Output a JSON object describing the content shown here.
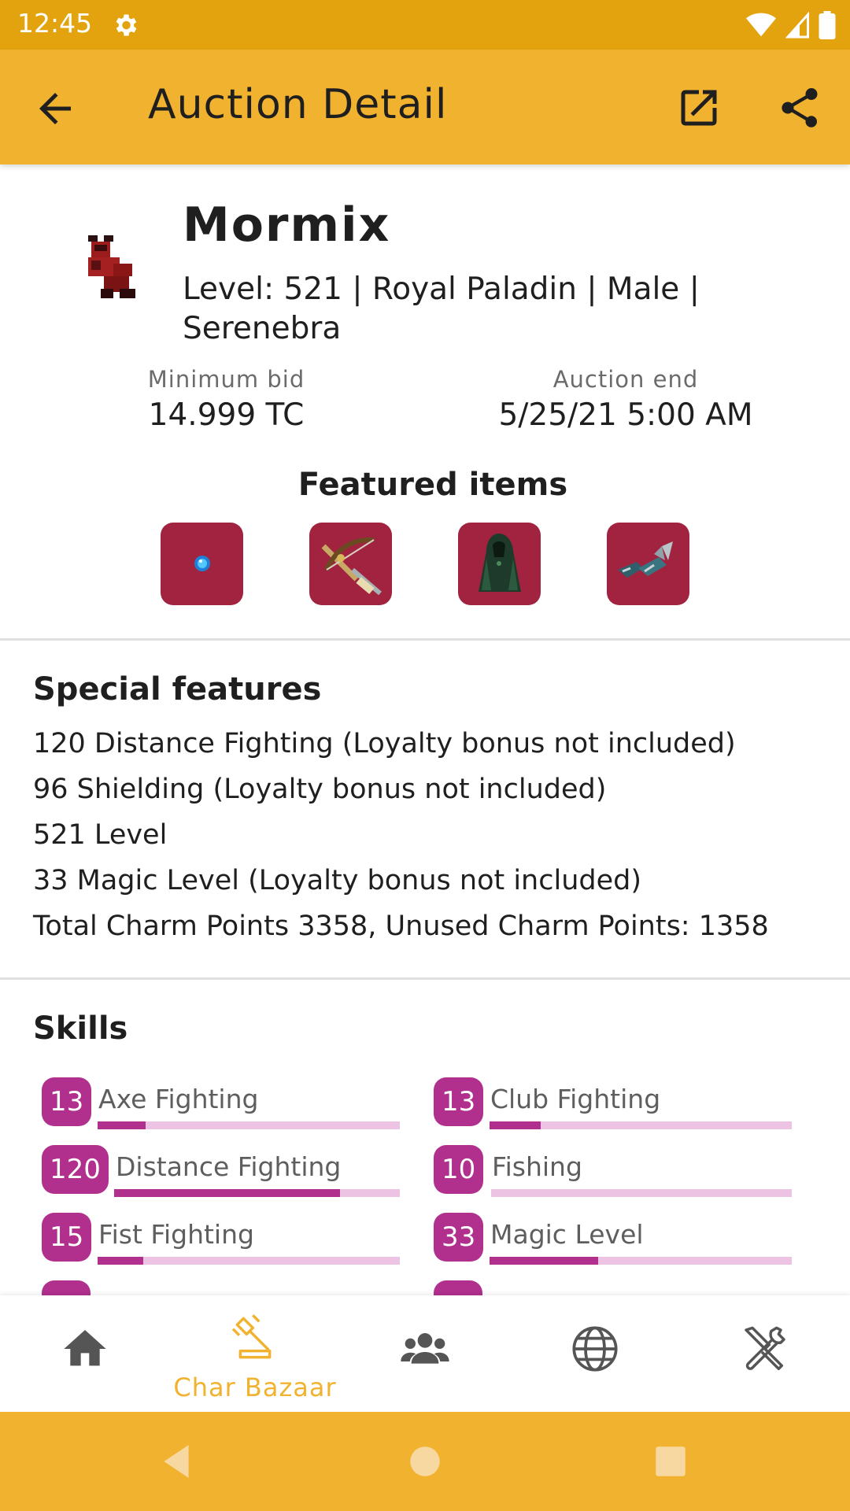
{
  "status_bar": {
    "time": "12:45",
    "icons": [
      "gear-icon",
      "wifi-icon",
      "signal-icon",
      "battery-icon"
    ]
  },
  "app_bar": {
    "title": "Auction Detail",
    "icons": [
      "back-arrow-icon",
      "open-external-icon",
      "share-icon"
    ]
  },
  "character": {
    "name": "Mormix",
    "info": "Level: 521 | Royal Paladin | Male | Serenebra"
  },
  "auction": {
    "min_bid_label": "Minimum bid",
    "min_bid_value": "14.999 TC",
    "end_label": "Auction end",
    "end_value": "5/25/21 5:00 AM"
  },
  "featured": {
    "title": "Featured items",
    "items": [
      "blue-gem-item",
      "crossbow-item",
      "robe-item",
      "boots-item"
    ],
    "item_bg": "#a12340"
  },
  "special_features": {
    "title": "Special features",
    "lines": [
      "120 Distance Fighting (Loyalty bonus not included)",
      "96 Shielding (Loyalty bonus not included)",
      "521 Level",
      "33 Magic Level (Loyalty bonus not included)",
      "Total Charm Points 3358, Unused Charm Points: 1358"
    ]
  },
  "skills": {
    "title": "Skills",
    "items": [
      {
        "level": "13",
        "name": "Axe Fighting",
        "progress": 0.16
      },
      {
        "level": "13",
        "name": "Club Fighting",
        "progress": 0.17
      },
      {
        "level": "120",
        "name": "Distance Fighting",
        "progress": 0.79
      },
      {
        "level": "10",
        "name": "Fishing",
        "progress": 0.0
      },
      {
        "level": "15",
        "name": "Fist Fighting",
        "progress": 0.15
      },
      {
        "level": "33",
        "name": "Magic Level",
        "progress": 0.36
      }
    ]
  },
  "bottom_nav": {
    "items": [
      {
        "icon": "home-icon",
        "label": ""
      },
      {
        "icon": "gavel-icon",
        "label": "Char Bazaar",
        "active": true
      },
      {
        "icon": "group-icon",
        "label": ""
      },
      {
        "icon": "globe-icon",
        "label": ""
      },
      {
        "icon": "tools-icon",
        "label": ""
      }
    ]
  },
  "colors": {
    "status_bar": "#e2a30f",
    "accent": "#f1b32f",
    "skill": "#b1308e",
    "skill_track": "#ecc3e3"
  }
}
